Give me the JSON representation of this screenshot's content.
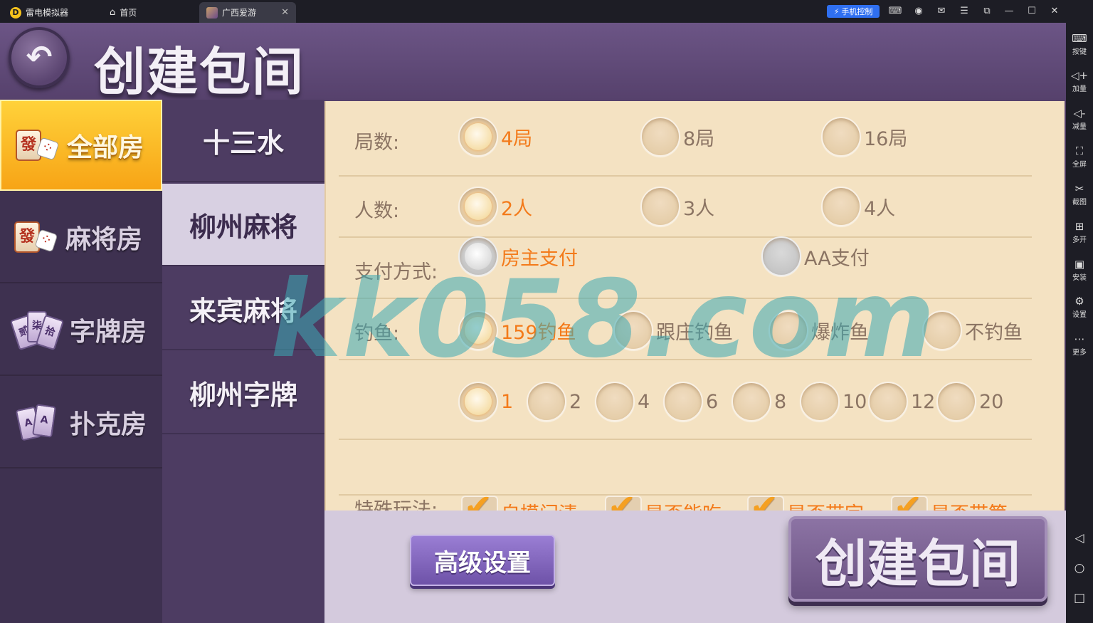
{
  "emulator": {
    "app_name": "雷电模拟器",
    "tabs": [
      {
        "label": "首页"
      },
      {
        "label": "广西爱游"
      }
    ],
    "phone_control": "手机控制",
    "sidebar": [
      {
        "icon": "keyboard-icon",
        "label": "按键"
      },
      {
        "icon": "volume-up-icon",
        "label": "加量"
      },
      {
        "icon": "volume-down-icon",
        "label": "减量"
      },
      {
        "icon": "fullscreen-icon",
        "label": "全屏"
      },
      {
        "icon": "scissors-icon",
        "label": "截图"
      },
      {
        "icon": "multi-instance-icon",
        "label": "多开"
      },
      {
        "icon": "apk-icon",
        "label": "安装"
      },
      {
        "icon": "settings-icon",
        "label": "设置"
      },
      {
        "icon": "more-icon",
        "label": "更多"
      }
    ]
  },
  "game": {
    "title": "创建包间",
    "categories": [
      {
        "label": "全部房",
        "tile": "發"
      },
      {
        "label": "麻将房",
        "tile": "發"
      },
      {
        "label": "字牌房",
        "cards": [
          "贰",
          "柒",
          "拾"
        ]
      },
      {
        "label": "扑克房",
        "cards": [
          "A",
          "A"
        ]
      }
    ],
    "active_category": 0,
    "sub_modes": [
      "十三水",
      "柳州麻将",
      "来宾麻将",
      "柳州字牌"
    ],
    "active_sub_mode": 1,
    "options": {
      "rounds": {
        "label": "局数:",
        "choices": [
          "4局",
          "8局",
          "16局"
        ],
        "selected": 0
      },
      "players": {
        "label": "人数:",
        "choices": [
          "2人",
          "3人",
          "4人"
        ],
        "selected": 0
      },
      "payment": {
        "label": "支付方式:",
        "choices": [
          "房主支付",
          "AA支付"
        ],
        "selected": 0
      },
      "fishing": {
        "label": "钓鱼:",
        "choices": [
          "159钓鱼",
          "跟庄钓鱼",
          "爆炸鱼",
          "不钓鱼"
        ],
        "selected": 0
      },
      "fish_count": {
        "choices": [
          "1",
          "2",
          "4",
          "6",
          "8",
          "10",
          "12",
          "20"
        ],
        "selected": 0
      },
      "special": {
        "label": "特殊玩法:",
        "choices": [
          "自摸门清",
          "是否能吃",
          "是否带字",
          "是否带筒"
        ],
        "checked": [
          true,
          true,
          true,
          true
        ]
      }
    },
    "advanced_button": "高级设置",
    "create_button": "创建包间"
  },
  "watermark": "kk058.com",
  "colors": {
    "accent_orange": "#f37a1a",
    "panel_bg": "#f4e2c2",
    "purple_bg": "#4d3c62",
    "active_gold": "#f7a416"
  }
}
